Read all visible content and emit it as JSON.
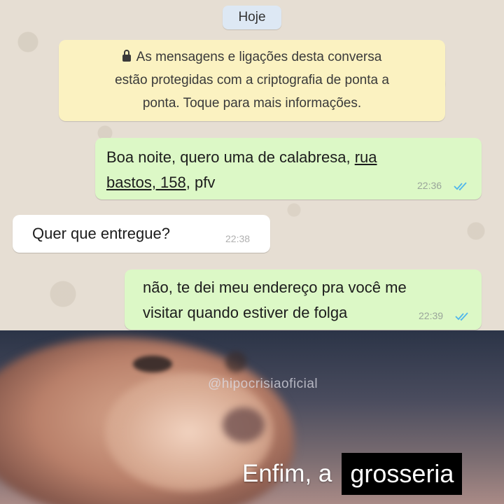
{
  "chat": {
    "date_chip": "Hoje",
    "encryption_notice": {
      "line1": "As mensagens e ligações desta conversa",
      "line2": "estão protegidas com a criptografia de ponta a",
      "line3": "ponta. Toque para mais informações."
    },
    "messages": [
      {
        "direction": "outgoing",
        "text_part1": "Boa noite, quero uma de calabresa, ",
        "text_link1": "rua",
        "text_link2": "bastos, 158",
        "text_part2": ", pfv",
        "time": "22:36",
        "status": "read"
      },
      {
        "direction": "incoming",
        "text": "Quer que entregue?",
        "time": "22:38"
      },
      {
        "direction": "outgoing",
        "line1": "não, te dei meu endereço pra você me",
        "line2": "visitar quando estiver de folga",
        "time": "22:39",
        "status": "read"
      }
    ]
  },
  "meme": {
    "watermark": "@hipocrisiaoficial",
    "caption_plain": "Enfim, a",
    "caption_boxed": "grosseria"
  },
  "colors": {
    "outgoing_bubble": "#dcf8c6",
    "incoming_bubble": "#ffffff",
    "encryption_bg": "#fbf2c1",
    "date_chip_bg": "#dde8f4",
    "read_ticks": "#4fb6ec"
  }
}
